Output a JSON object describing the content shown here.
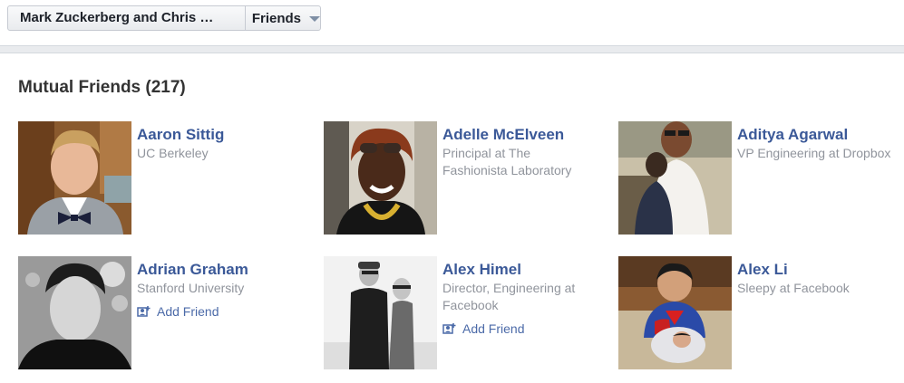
{
  "header": {
    "selector_name": "Mark Zuckerberg and Chris …",
    "dropdown_label": "Friends"
  },
  "section": {
    "title": "Mutual Friends (217)"
  },
  "friends": [
    {
      "name": "Aaron Sittig",
      "line1": "UC Berkeley",
      "line2": "",
      "add_friend": ""
    },
    {
      "name": "Adelle McElveen",
      "line1": "Principal at The",
      "line2": "Fashionista Laboratory",
      "add_friend": ""
    },
    {
      "name": "Aditya Agarwal",
      "line1": "VP Engineering at Dropbox",
      "line2": "",
      "add_friend": ""
    },
    {
      "name": "Adrian Graham",
      "line1": "Stanford University",
      "line2": "",
      "add_friend": "Add Friend"
    },
    {
      "name": "Alex Himel",
      "line1": "Director, Engineering at",
      "line2": "Facebook",
      "add_friend": "Add Friend"
    },
    {
      "name": "Alex Li",
      "line1": "Sleepy at Facebook",
      "line2": "",
      "add_friend": ""
    }
  ],
  "colors": {
    "link": "#3b5998",
    "muted": "#90949c",
    "divider": "#e9ebee"
  }
}
